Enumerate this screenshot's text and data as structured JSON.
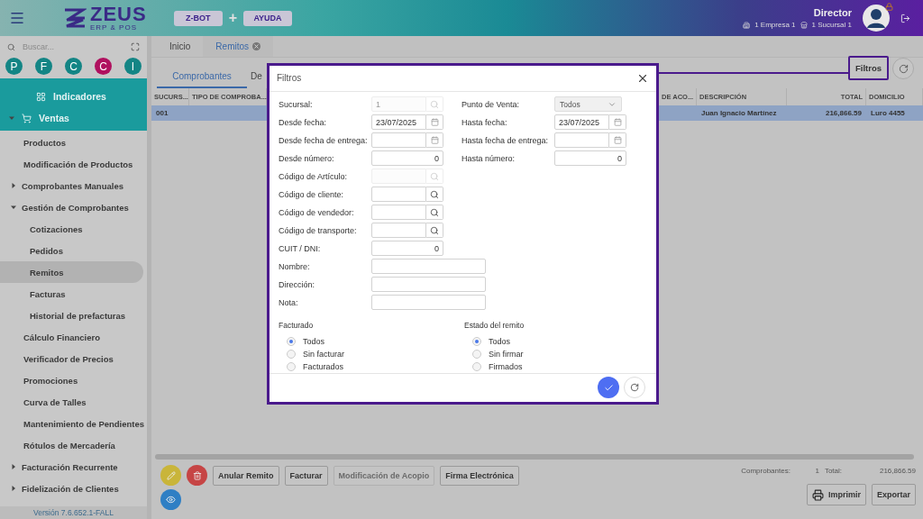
{
  "header": {
    "logo_title": "ZEUS",
    "logo_subtitle": "ERP & POS",
    "buttons": [
      "Z-BOT",
      "AYUDA"
    ],
    "separator": "+",
    "user": "Director",
    "empresa": "1 Empresa 1",
    "sucursal": "1 Sucursal 1"
  },
  "sidebar": {
    "search": {
      "placeholder": "Buscar..."
    },
    "shortcuts": [
      {
        "label": "P",
        "color": "#138585"
      },
      {
        "label": "F",
        "color": "#138585"
      },
      {
        "label": "C",
        "color": "#138585"
      },
      {
        "label": "C",
        "color": "#b0115f"
      },
      {
        "label": "I",
        "color": "#138585"
      }
    ],
    "sections": [
      {
        "label": "Indicadores"
      },
      {
        "label": "Ventas",
        "expanded": true
      }
    ],
    "items": [
      {
        "label": "Productos",
        "selected": false
      },
      {
        "label": "Modificación de Productos",
        "selected": false
      },
      {
        "label": "Comprobantes Manuales",
        "selected": false,
        "expanded": false
      },
      {
        "label": "Gestión de Comprobantes",
        "selected": false,
        "expanded": true,
        "children": [
          {
            "label": "Cotizaciones",
            "selected": false
          },
          {
            "label": "Pedidos",
            "selected": false
          },
          {
            "label": "Remitos",
            "selected": true
          },
          {
            "label": "Facturas",
            "selected": false
          },
          {
            "label": "Historial de prefacturas",
            "selected": false
          }
        ]
      },
      {
        "label": "Cálculo Financiero",
        "selected": false
      },
      {
        "label": "Verificador de Precios",
        "selected": false
      },
      {
        "label": "Promociones",
        "selected": false
      },
      {
        "label": "Curva de Talles",
        "selected": false
      },
      {
        "label": "Mantenimiento de Pendientes",
        "selected": false
      },
      {
        "label": "Rótulos de Mercadería",
        "selected": false
      },
      {
        "label": "Facturación Recurrente",
        "selected": false,
        "expanded": false
      },
      {
        "label": "Fidelización de Clientes",
        "selected": false,
        "expanded": false
      }
    ],
    "version": "Versión 7.6.652.1-FALL"
  },
  "tabs": [
    {
      "label": "Inicio",
      "selected": false,
      "closable": false
    },
    {
      "label": "Remitos",
      "selected": true,
      "closable": true
    }
  ],
  "subtabs": [
    {
      "label": "Comprobantes",
      "selected": true
    },
    {
      "label": "De",
      "selected": false
    }
  ],
  "toolbar": {
    "filter_button": "Filtros",
    "highlighted": true
  },
  "table": {
    "columns": [
      "SUCURS...",
      "TIPO DE COMPROBA...",
      "DE ACO...",
      "DESCRIPCIÓN",
      "TOTAL",
      "DOMICILIO"
    ],
    "rows": [
      {
        "selected": true,
        "cells": [
          "001",
          null,
          null,
          "Juan Ignacio Martínez",
          "216,866.59",
          "Luro 4455"
        ]
      }
    ]
  },
  "actions": {
    "buttons": [
      {
        "label": "Anular Remito",
        "disabled": false
      },
      {
        "label": "Facturar",
        "disabled": false
      },
      {
        "label": "Modificación de Acopio",
        "disabled": true
      },
      {
        "label": "Firma Electrónica",
        "disabled": false
      }
    ],
    "round": [
      {
        "kind": "edit",
        "color": "#c9b53a"
      },
      {
        "kind": "delete",
        "color": "#c64545"
      },
      {
        "kind": "view",
        "color": "#2f7fc4"
      }
    ],
    "summary": {
      "count_label": "Comprobantes:",
      "count": "1",
      "total_label": "Total:",
      "total": "216,866.59"
    },
    "print": "Imprimir",
    "export": "Exportar"
  },
  "dialog": {
    "title": "Filtros",
    "pairs": [
      {
        "left": {
          "label": "Sucursal:",
          "value": "1",
          "kind": "search",
          "disabled": true
        },
        "right": {
          "label": "Punto de Venta:",
          "value": "Todos",
          "kind": "select"
        }
      },
      {
        "left": {
          "label": "Desde fecha:",
          "value": "23/07/2025",
          "kind": "date",
          "disabled": false
        },
        "right": {
          "label": "Hasta fecha:",
          "value": "23/07/2025",
          "kind": "date",
          "disabled": false
        }
      },
      {
        "left": {
          "label": "Desde fecha de entrega:",
          "kind": "date",
          "disabled": false
        },
        "right": {
          "label": "Hasta fecha de entrega:",
          "kind": "date",
          "disabled": false
        }
      },
      {
        "left": {
          "label": "Desde número:",
          "value": "0",
          "kind": "number",
          "disabled": false
        },
        "right": {
          "label": "Hasta número:",
          "value": "0",
          "kind": "number",
          "disabled": false
        }
      },
      {
        "left": {
          "label": "Código de Artículo:",
          "kind": "search",
          "disabled": true
        }
      },
      {
        "left": {
          "label": "Código de cliente:",
          "kind": "search",
          "disabled": false
        }
      },
      {
        "left": {
          "label": "Código de vendedor:",
          "kind": "search",
          "disabled": false
        }
      },
      {
        "left": {
          "label": "Código de transporte:",
          "kind": "search",
          "disabled": false
        }
      },
      {
        "left": {
          "label": "CUIT / DNI:",
          "value": "0",
          "kind": "number",
          "disabled": false
        }
      },
      {
        "left": {
          "label": "Nombre:",
          "kind": "wide",
          "disabled": false
        }
      },
      {
        "left": {
          "label": "Dirección:",
          "kind": "wide",
          "disabled": false
        }
      },
      {
        "left": {
          "label": "Nota:",
          "kind": "wide",
          "disabled": false
        }
      }
    ],
    "radio_groups": [
      {
        "title": "Facturado",
        "options": [
          {
            "label": "Todos",
            "selected": true
          },
          {
            "label": "Sin facturar",
            "selected": false
          },
          {
            "label": "Facturados",
            "selected": false
          }
        ]
      },
      {
        "title": "Estado del remito",
        "options": [
          {
            "label": "Todos",
            "selected": true
          },
          {
            "label": "Sin firmar",
            "selected": false
          },
          {
            "label": "Firmados",
            "selected": false
          }
        ]
      }
    ]
  }
}
